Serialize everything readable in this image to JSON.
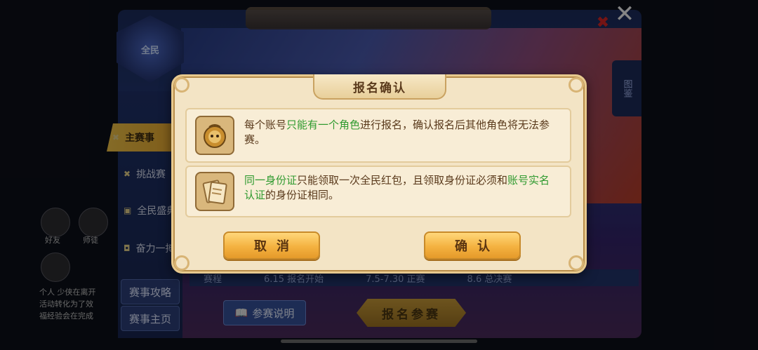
{
  "background": {
    "logo_text": "全民",
    "sidebar_items": [
      {
        "label": "主赛事",
        "icon": "crossed-swords-icon",
        "active": true
      },
      {
        "label": "挑战赛",
        "icon": "crossed-swords-icon",
        "active": false
      },
      {
        "label": "全民盛典",
        "icon": "gift-icon",
        "active": false
      },
      {
        "label": "奋力一搏",
        "icon": "badge-icon",
        "active": false
      }
    ],
    "side_buttons": [
      "赛事攻略",
      "赛事主页"
    ],
    "right_tab": "图鉴",
    "schedule": [
      "赛程",
      "6.15 报名开始",
      "7.5-7.30 正赛",
      "8.6 总决赛"
    ],
    "rules_button": "参赛说明",
    "signup_button": "报名参赛",
    "hud": {
      "friends_label": "好友",
      "master_label": "师徒",
      "chat_preview": [
        "个人 少侠在离开",
        "活动转化为了效",
        "福经验会在完成"
      ]
    }
  },
  "dialog": {
    "title": "报名确认",
    "notices": [
      {
        "icon": "coin-mascot-icon",
        "segments": [
          {
            "text": "每个账号",
            "highlight": false
          },
          {
            "text": "只能有一个角色",
            "highlight": true
          },
          {
            "text": "进行报名，确认报名后其他角色将无法参赛。",
            "highlight": false
          }
        ]
      },
      {
        "icon": "id-cards-icon",
        "segments": [
          {
            "text": "同一身份证",
            "highlight": true
          },
          {
            "text": "只能领取一次全民红包，且领取身份证必须和",
            "highlight": false
          },
          {
            "text": "账号实名认证",
            "highlight": true
          },
          {
            "text": "的身份证相同。",
            "highlight": false
          }
        ]
      }
    ],
    "cancel_label": "取消",
    "confirm_label": "确认"
  },
  "colors": {
    "highlight": "#2f9a2f",
    "dialog_text": "#5a3a1c",
    "button_gold": "#f4b240"
  }
}
